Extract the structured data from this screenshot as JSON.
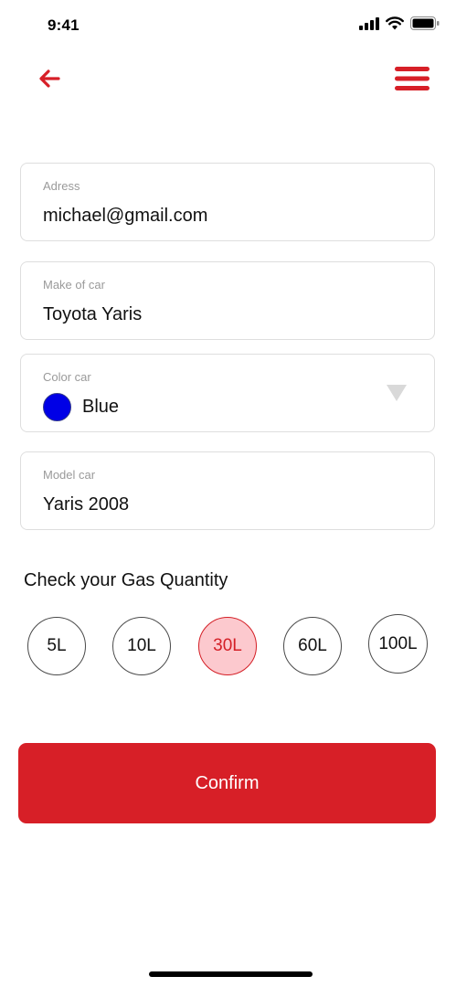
{
  "status_bar": {
    "time": "9:41",
    "icons": [
      "cellular-signal-icon",
      "wifi-icon",
      "battery-icon"
    ]
  },
  "header": {
    "back_icon": "arrow-left-icon",
    "menu_icon": "hamburger-menu-icon",
    "accent_color": "#d71f27"
  },
  "form": {
    "address": {
      "label": "Adress",
      "value": "michael@gmail.com"
    },
    "make": {
      "label": "Make of car",
      "value": "Toyota Yaris"
    },
    "color": {
      "label": "Color car",
      "value": "Blue",
      "swatch": "#0000e6"
    },
    "model": {
      "label": "Model car",
      "value": "Yaris 2008"
    }
  },
  "gas": {
    "title": "Check your Gas Quantity",
    "options": [
      "5L",
      "10L",
      "30L",
      "60L",
      "100L"
    ],
    "selected": "30L"
  },
  "confirm": {
    "label": "Confirm"
  }
}
